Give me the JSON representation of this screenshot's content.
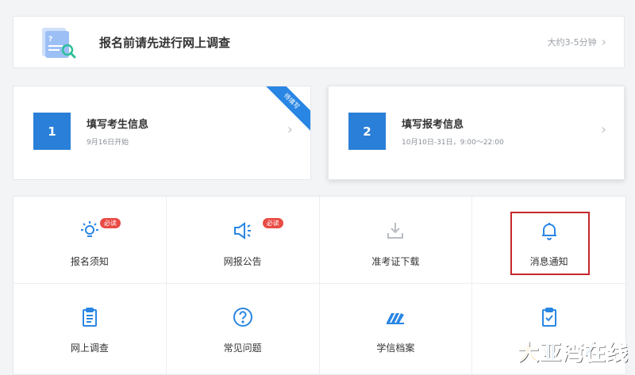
{
  "survey": {
    "title": "报名前请先进行网上调查",
    "time": "大约3-5分钟"
  },
  "steps": [
    {
      "num": "1",
      "title": "填写考生信息",
      "sub": "9月16日开始",
      "ribbon": "待填写"
    },
    {
      "num": "2",
      "title": "填写报考信息",
      "sub": "10月10日-31日，9:00～22:00"
    }
  ],
  "grid": [
    {
      "label": "报名须知",
      "icon": "lightbulb-icon",
      "badge": "必读"
    },
    {
      "label": "网报公告",
      "icon": "megaphone-icon",
      "badge": "必读"
    },
    {
      "label": "准考证下载",
      "icon": "download-icon"
    },
    {
      "label": "消息通知",
      "icon": "bell-icon"
    },
    {
      "label": "网上调查",
      "icon": "clipboard-list-icon"
    },
    {
      "label": "常见问题",
      "icon": "question-circle-icon"
    },
    {
      "label": "学信档案",
      "icon": "books-icon"
    },
    {
      "label": "",
      "icon": "clipboard-check-icon"
    }
  ],
  "watermark": [
    "大",
    "亚",
    "湾",
    "在",
    "线"
  ],
  "colors": {
    "accent": "#2a7fd8",
    "badge": "#e94b45",
    "highlight": "#c6282c"
  }
}
